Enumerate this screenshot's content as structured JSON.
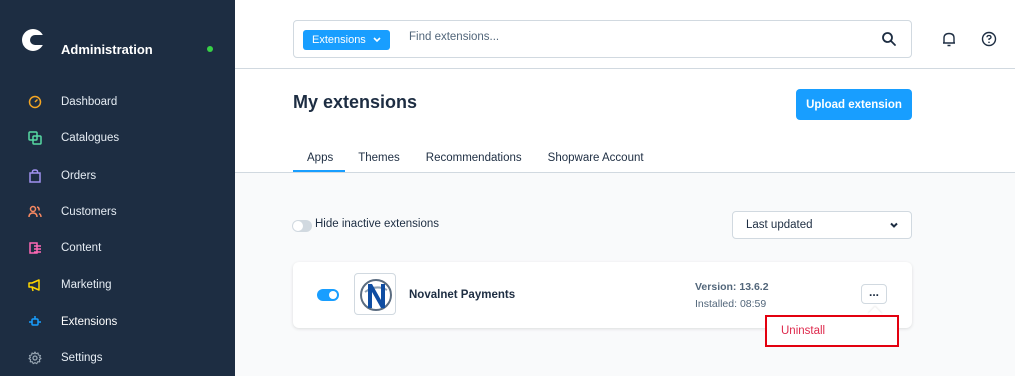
{
  "sidebar": {
    "title": "Administration",
    "status_color": "#37d046",
    "items": [
      {
        "label": "Dashboard",
        "icon": "dashboard-icon",
        "color": "#f5a623"
      },
      {
        "label": "Catalogues",
        "icon": "catalogue-icon",
        "color": "#57d9a3"
      },
      {
        "label": "Orders",
        "icon": "orders-icon",
        "color": "#a092f0"
      },
      {
        "label": "Customers",
        "icon": "customers-icon",
        "color": "#f88962"
      },
      {
        "label": "Content",
        "icon": "content-icon",
        "color": "#ff68b4"
      },
      {
        "label": "Marketing",
        "icon": "marketing-icon",
        "color": "#ffd700"
      },
      {
        "label": "Extensions",
        "icon": "extensions-icon",
        "color": "#189eff",
        "active": true
      },
      {
        "label": "Settings",
        "icon": "settings-icon",
        "color": "#9aa8b5"
      }
    ]
  },
  "search": {
    "type_label": "Extensions",
    "placeholder": "Find extensions..."
  },
  "header": {
    "title": "My extensions",
    "upload_label": "Upload extension"
  },
  "tabs": [
    {
      "label": "Apps",
      "active": true
    },
    {
      "label": "Themes"
    },
    {
      "label": "Recommendations"
    },
    {
      "label": "Shopware Account"
    }
  ],
  "filters": {
    "hide_inactive_label": "Hide inactive extensions",
    "hide_inactive_enabled": false,
    "sort_value": "Last updated"
  },
  "extension": {
    "name": "Novalnet Payments",
    "active": true,
    "version": "Version: 13.6.2",
    "installed": "Installed: 08:59",
    "menu_label": "..."
  },
  "context_menu": {
    "uninstall_label": "Uninstall"
  },
  "colors": {
    "accent": "#189eff",
    "sidebar_bg": "#1d2d42",
    "danger": "#de294c",
    "highlight": "#e3000f"
  }
}
